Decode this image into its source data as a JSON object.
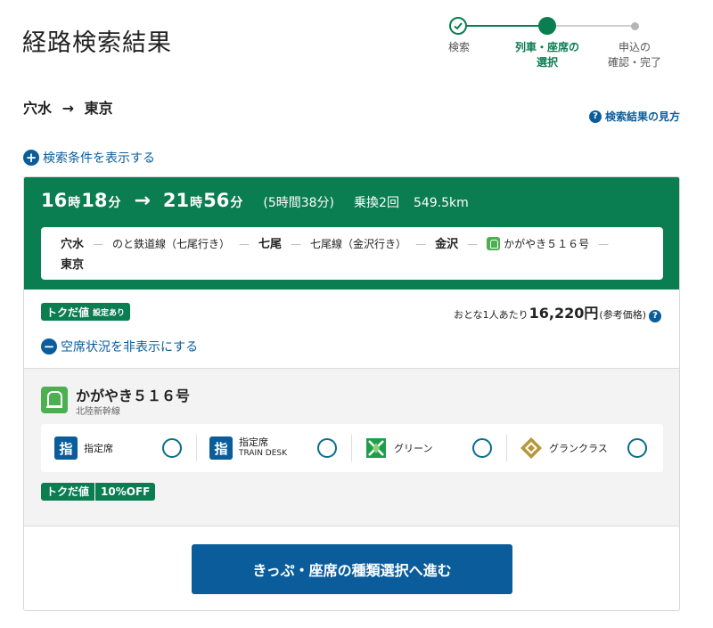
{
  "page": {
    "title": "経路検索結果"
  },
  "stepper": {
    "steps": [
      {
        "label": "検索",
        "state": "done"
      },
      {
        "label": "列車・座席の\n選択",
        "state": "current"
      },
      {
        "label": "申込の\n確認・完了",
        "state": "todo"
      }
    ]
  },
  "route": {
    "from": "穴水",
    "arrow": "→",
    "to": "東京"
  },
  "help_link": {
    "label": "検索結果の見方"
  },
  "show_conditions": {
    "label": "検索条件を表示する"
  },
  "result": {
    "dep_hour": "16",
    "dep_min": "18",
    "arr_hour": "21",
    "arr_min": "56",
    "unit_hour": "時",
    "unit_min": "分",
    "arrow": "→",
    "duration": "(5時間38分)",
    "transfers": "乗換2回",
    "distance": "549.5km",
    "path": [
      {
        "type": "station",
        "text": "穴水"
      },
      {
        "type": "line",
        "text": "のと鉄道線（七尾行き）"
      },
      {
        "type": "station",
        "text": "七尾"
      },
      {
        "type": "line",
        "text": "七尾線（金沢行き）"
      },
      {
        "type": "station",
        "text": "金沢"
      },
      {
        "type": "train",
        "text": "かがやき５１６号"
      },
      {
        "type": "station",
        "text": "東京"
      }
    ],
    "toku_badge": {
      "main": "トクだ値",
      "sub": "設定あり"
    },
    "price": {
      "prefix": "おとな1人あたり",
      "value": "16,220円",
      "note": "(参考価格)"
    },
    "hide_seats": {
      "label": "空席状況を非表示にする"
    }
  },
  "train": {
    "name": "かがやき５１６号",
    "line": "北陸新幹線",
    "seats": [
      {
        "label": "指定席",
        "sub": "",
        "icon": "shitei-icon"
      },
      {
        "label": "指定席",
        "sub": "TRAIN DESK",
        "icon": "shitei-icon"
      },
      {
        "label": "グリーン",
        "sub": "",
        "icon": "green-car-icon"
      },
      {
        "label": "グランクラス",
        "sub": "",
        "icon": "gran-class-icon"
      }
    ],
    "discount_badge": {
      "main": "トクだ値",
      "sub": "10%OFF"
    }
  },
  "proceed_button": {
    "label": "きっぷ・座席の種類選択へ進む"
  },
  "colors": {
    "green": "#0a7d51",
    "blue": "#0a5d9a",
    "light_green": "#4caf50",
    "gold": "#b8963a"
  }
}
